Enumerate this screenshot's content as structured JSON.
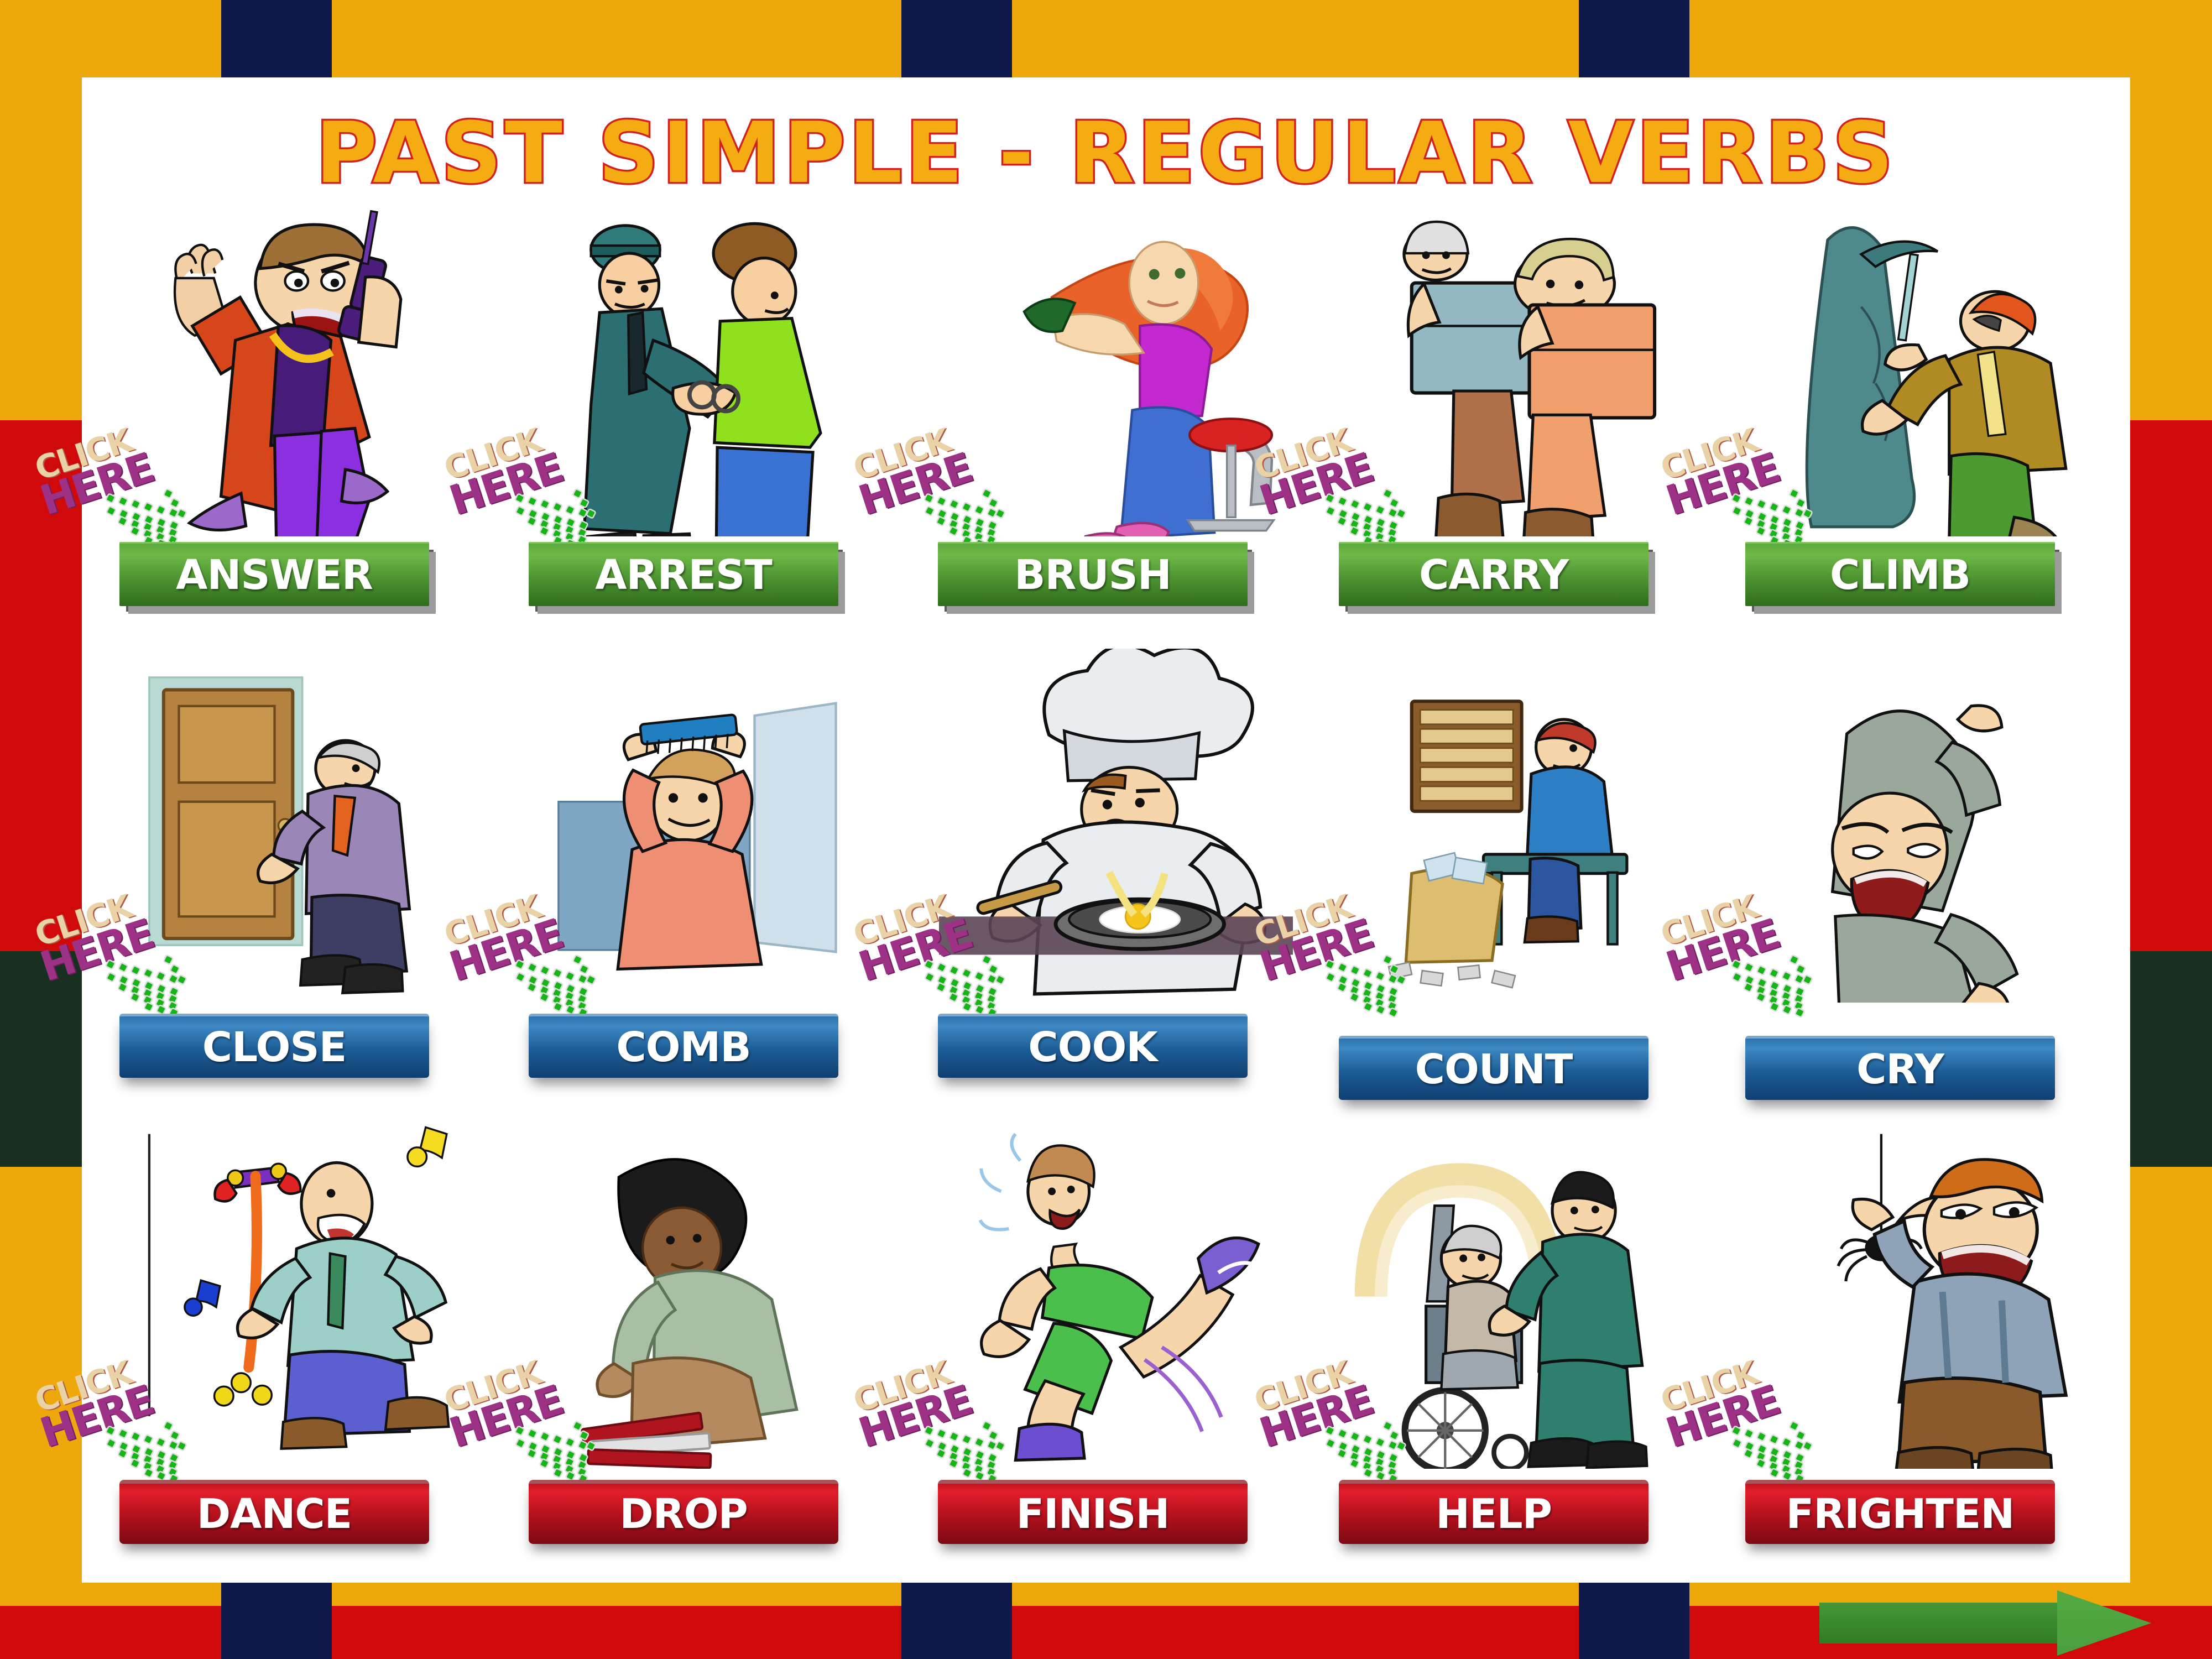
{
  "title": "PAST SIMPLE - REGULAR VERBS",
  "badge": {
    "line1": "CLICK",
    "line2": "HERE"
  },
  "colors": {
    "frame_gold": "#efa80b",
    "frame_navy": "#10194c",
    "frame_red": "#d00a0a",
    "frame_green": "#17301f",
    "title_fill": "#f5ab12",
    "title_stroke": "#d42020",
    "button_green": "#4d9431",
    "button_blue": "#1c5c96",
    "button_red": "#b0101c",
    "next_arrow": "#3a8c2e"
  },
  "rows": [
    {
      "style": "green",
      "cells": [
        {
          "label": "ANSWER",
          "art": "man-answering-phone"
        },
        {
          "label": "ARREST",
          "art": "policeman-arresting-man"
        },
        {
          "label": "BRUSH",
          "art": "woman-brushing-hair"
        },
        {
          "label": "CARRY",
          "art": "two-men-carrying-boxes"
        },
        {
          "label": "CLIMB",
          "art": "climber-on-rock-face"
        }
      ]
    },
    {
      "style": "blue",
      "cells": [
        {
          "label": "CLOSE",
          "art": "man-closing-door"
        },
        {
          "label": "COMB",
          "art": "man-combing-hair-in-mirror"
        },
        {
          "label": "COOK",
          "art": "chef-frying-egg"
        },
        {
          "label": "COUNT",
          "art": "man-counting-money",
          "lower": true
        },
        {
          "label": "CRY",
          "art": "man-crying",
          "lower": true
        }
      ]
    },
    {
      "style": "red",
      "cells": [
        {
          "label": "DANCE",
          "art": "man-dancing-with-cane"
        },
        {
          "label": "DROP",
          "art": "woman-dropping-books"
        },
        {
          "label": "FINISH",
          "art": "runner-finishing-race"
        },
        {
          "label": "HELP",
          "art": "nurse-helping-wheelchair-patient"
        },
        {
          "label": "FRIGHTEN",
          "art": "man-frightened-by-spider"
        }
      ]
    }
  ],
  "next_button": {
    "name": "next-slide-arrow"
  }
}
